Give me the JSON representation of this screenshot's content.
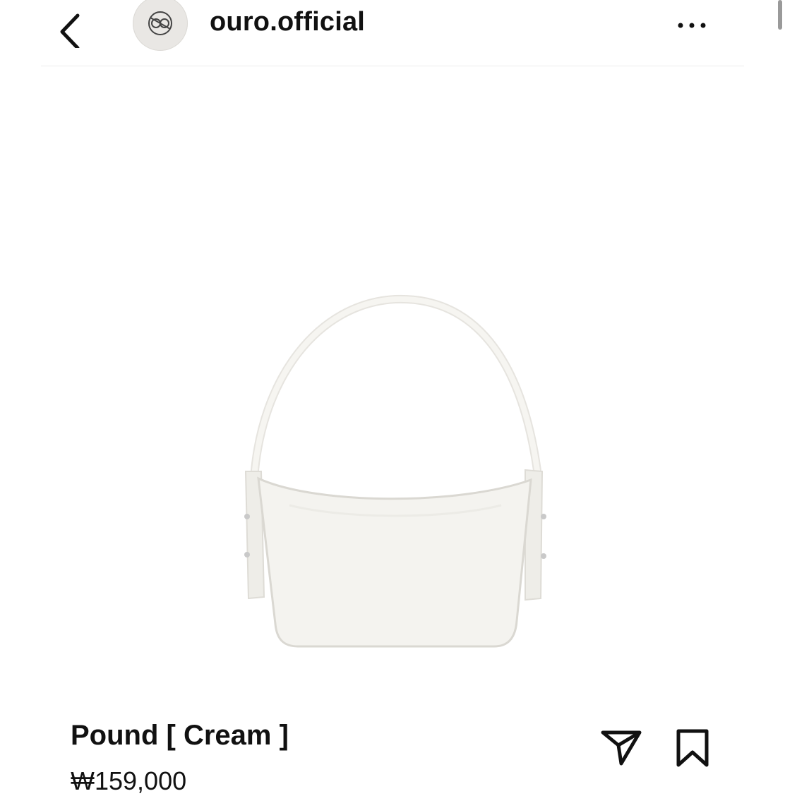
{
  "header": {
    "username": "ouro.official",
    "back_icon": "chevron-left-icon",
    "more_icon": "more-horizontal-icon"
  },
  "product": {
    "title": "Pound [ Cream ]",
    "price": "₩159,000",
    "image_label": "handbag-image",
    "bag_color": "#f4f3ef"
  },
  "actions": {
    "share_icon": "send-icon",
    "save_icon": "bookmark-icon"
  }
}
